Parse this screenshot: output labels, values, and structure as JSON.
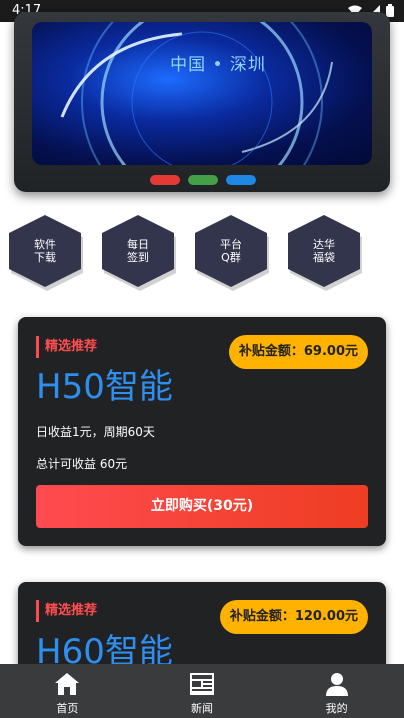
{
  "status_bar": {
    "time": "4:17"
  },
  "banner": {
    "text": "中国 • 深圳",
    "dot_colors": [
      "#e53935",
      "#43a047",
      "#1e88e5"
    ]
  },
  "menu": [
    {
      "line1": "软件",
      "line2": "下载"
    },
    {
      "line1": "每日",
      "line2": "签到"
    },
    {
      "line1": "平台",
      "line2": "Q群"
    },
    {
      "line1": "达华",
      "line2": "福袋"
    }
  ],
  "products": [
    {
      "tag": "精选推荐",
      "subsidy": "补贴金额：69.00元",
      "name": "H50智能",
      "daily": "日收益1元，周期60天",
      "total": "总计可收益 60元",
      "button": "立即购买(30元)"
    },
    {
      "tag": "精选推荐",
      "subsidy": "补贴金额：120.00元",
      "name": "H60智能"
    }
  ],
  "nav": [
    {
      "label": "首页",
      "icon": "home-icon"
    },
    {
      "label": "新闻",
      "icon": "news-icon"
    },
    {
      "label": "我的",
      "icon": "user-icon"
    }
  ],
  "colors": {
    "accent_blue": "#2f8ff0",
    "tag_red": "#ff4d4f",
    "subsidy_yellow": "#ffb300",
    "card_bg": "#202224"
  }
}
